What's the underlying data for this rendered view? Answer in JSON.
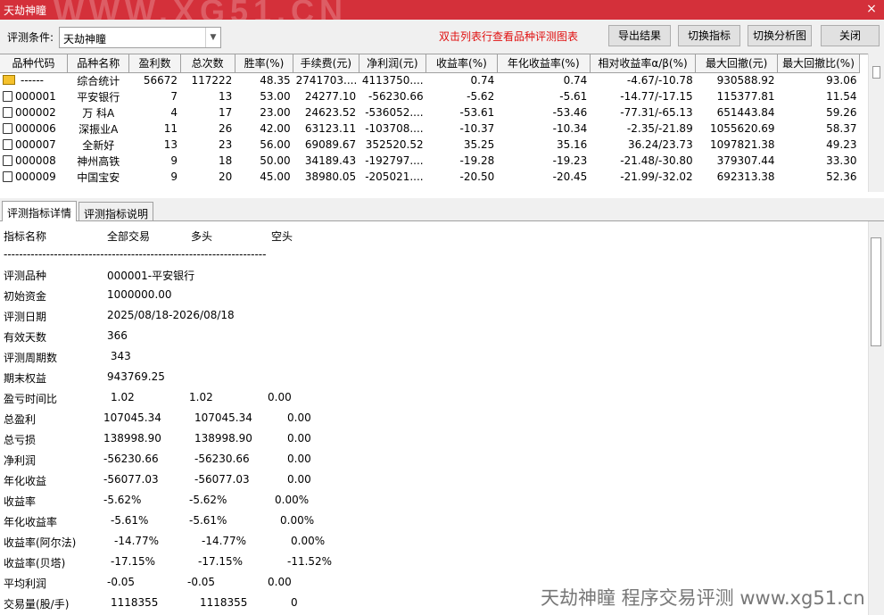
{
  "window": {
    "title": "天劫神瞳",
    "watermark": "WWW.XG51.CN",
    "close": "×"
  },
  "toolbar": {
    "condition_label": "评测条件:",
    "condition_value": "天劫神瞳",
    "hint": "双击列表行查看品种评测图表",
    "export_btn": "导出结果",
    "switch_indicator_btn": "切换指标",
    "switch_chart_btn": "切换分析图",
    "close_btn": "关闭"
  },
  "table": {
    "columns": [
      "品种代码",
      "品种名称",
      "盈利数",
      "总次数",
      "胜率(%)",
      "手续费(元)",
      "净利润(元)",
      "收益率(%)",
      "年化收益率(%)",
      "相对收益率α/β(%)",
      "最大回撤(元)",
      "最大回撤比(%)"
    ],
    "rows": [
      [
        "------",
        "综合统计",
        "56672",
        "117222",
        "48.35",
        "2741703....",
        "4113750....",
        "0.74",
        "0.74",
        "-4.67/-10.78",
        "930588.92",
        "93.06"
      ],
      [
        "000001",
        "平安银行",
        "7",
        "13",
        "53.00",
        "24277.10",
        "-56230.66",
        "-5.62",
        "-5.61",
        "-14.77/-17.15",
        "115377.81",
        "11.54"
      ],
      [
        "000002",
        "万 科A",
        "4",
        "17",
        "23.00",
        "24623.52",
        "-536052....",
        "-53.61",
        "-53.46",
        "-77.31/-65.13",
        "651443.84",
        "59.26"
      ],
      [
        "000006",
        "深振业A",
        "11",
        "26",
        "42.00",
        "63123.11",
        "-103708....",
        "-10.37",
        "-10.34",
        "-2.35/-21.89",
        "1055620.69",
        "58.37"
      ],
      [
        "000007",
        "全新好",
        "13",
        "23",
        "56.00",
        "69089.67",
        "352520.52",
        "35.25",
        "35.16",
        "36.24/23.73",
        "1097821.38",
        "49.23"
      ],
      [
        "000008",
        "神州高铁",
        "9",
        "18",
        "50.00",
        "34189.43",
        "-192797....",
        "-19.28",
        "-19.23",
        "-21.48/-30.80",
        "379307.44",
        "33.30"
      ],
      [
        "000009",
        "中国宝安",
        "9",
        "20",
        "45.00",
        "38980.05",
        "-205021....",
        "-20.50",
        "-20.45",
        "-21.99/-32.02",
        "692313.38",
        "52.36"
      ]
    ]
  },
  "tabs": [
    "评测指标详情",
    "评测指标说明"
  ],
  "detail": {
    "header": [
      "指标名称",
      "全部交易",
      "多头",
      "空头"
    ],
    "separator": "--------------------------------------------------------------------",
    "info": [
      [
        "评测品种",
        "000001-平安银行"
      ],
      [
        "初始资金",
        "1000000.00"
      ],
      [
        "评测日期",
        "2025/08/18-2026/08/18"
      ],
      [
        "有效天数",
        "366"
      ],
      [
        "评测周期数",
        " 343"
      ],
      [
        "期末权益",
        "943769.25"
      ]
    ],
    "metrics": [
      [
        "盈亏时间比",
        "1.02",
        "1.02",
        "0.00"
      ],
      [
        "总盈利",
        "107045.34",
        "107045.34",
        "0.00"
      ],
      [
        "总亏损",
        "138998.90",
        "138998.90",
        "0.00"
      ],
      [
        "净利润",
        "-56230.66",
        "-56230.66",
        "0.00"
      ],
      [
        "年化收益",
        "-56077.03",
        "-56077.03",
        "0.00"
      ],
      [
        "收益率",
        "-5.62%",
        "-5.62%",
        "0.00%"
      ],
      [
        "年化收益率",
        "-5.61%",
        "-5.61%",
        "0.00%"
      ],
      [
        "收益率(阿尔法)",
        "-14.77%",
        "-14.77%",
        "0.00%"
      ],
      [
        "收益率(贝塔)",
        "-17.15%",
        "-17.15%",
        "-11.52%"
      ],
      [
        "平均利润",
        "-0.05",
        "-0.05",
        "0.00"
      ],
      [
        "交易量(股/手)",
        "1118355",
        "1118355",
        "0"
      ]
    ]
  },
  "footer_watermark": "天劫神瞳 程序交易评测 www.xg51.cn",
  "colors": {
    "titlebar": "#d4303a",
    "hint": "#e01010"
  }
}
